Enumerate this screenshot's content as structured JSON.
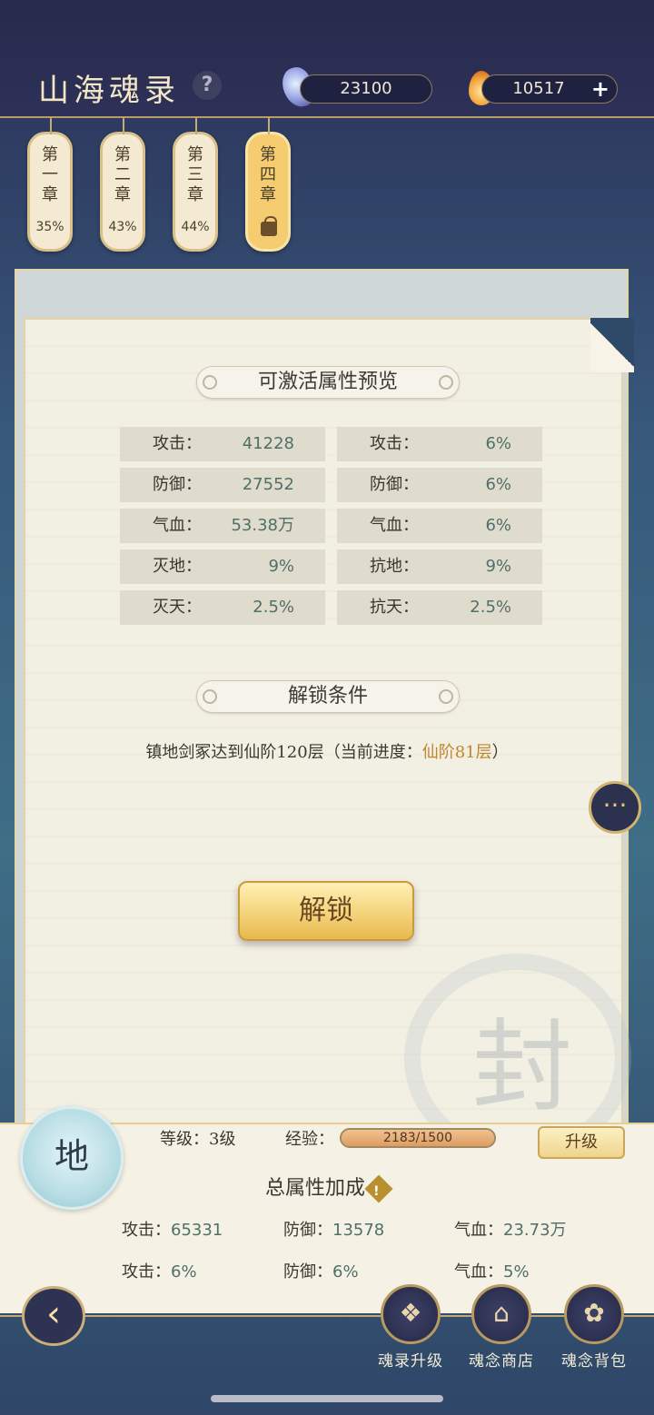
{
  "header": {
    "title": "山海魂录",
    "help_icon": "question-icon",
    "soul_currency": "23100",
    "flame_currency": "10517",
    "plus_icon": "+"
  },
  "chapters": [
    {
      "label": "第一章",
      "progress": "35%"
    },
    {
      "label": "第二章",
      "progress": "43%"
    },
    {
      "label": "第三章",
      "progress": "44%"
    },
    {
      "label": "第四章",
      "locked": true
    }
  ],
  "preview": {
    "title": "可激活属性预览",
    "left": [
      {
        "name": "攻击：",
        "value": "41228"
      },
      {
        "name": "防御：",
        "value": "27552"
      },
      {
        "name": "气血：",
        "value": "53.38万"
      },
      {
        "name": "灭地：",
        "value": "9%"
      },
      {
        "name": "灭天：",
        "value": "2.5%"
      }
    ],
    "right": [
      {
        "name": "攻击：",
        "value": "6%"
      },
      {
        "name": "防御：",
        "value": "6%"
      },
      {
        "name": "气血：",
        "value": "6%"
      },
      {
        "name": "抗地：",
        "value": "9%"
      },
      {
        "name": "抗天：",
        "value": "2.5%"
      }
    ]
  },
  "unlock": {
    "title": "解锁条件",
    "condition": "镇地剑冢达到仙阶120层（当前进度：",
    "progress": "仙阶81层",
    "close_paren": "）",
    "button": "解锁"
  },
  "chat_icon": "···",
  "watermark_glyph": "封",
  "bottom": {
    "element": "地",
    "level": "等级：3级",
    "exp_label": "经验：",
    "exp_text": "2183/1500",
    "exp_fraction": 1.0,
    "upgrade": "升级",
    "total_title": "总属性加成",
    "warn_icon": "!",
    "stats": [
      {
        "name": "攻击：",
        "value": "65331"
      },
      {
        "name": "防御：",
        "value": "13578"
      },
      {
        "name": "气血：",
        "value": "23.73万"
      },
      {
        "name": "攻击：",
        "value": "6%"
      },
      {
        "name": "防御：",
        "value": "6%"
      },
      {
        "name": "气血：",
        "value": "5%"
      }
    ]
  },
  "nav": {
    "back_icon": "‹",
    "items": [
      {
        "label": "魂录升级",
        "icon": "book-icon"
      },
      {
        "label": "魂念商店",
        "icon": "shop-icon"
      },
      {
        "label": "魂念背包",
        "icon": "bag-icon"
      }
    ]
  }
}
